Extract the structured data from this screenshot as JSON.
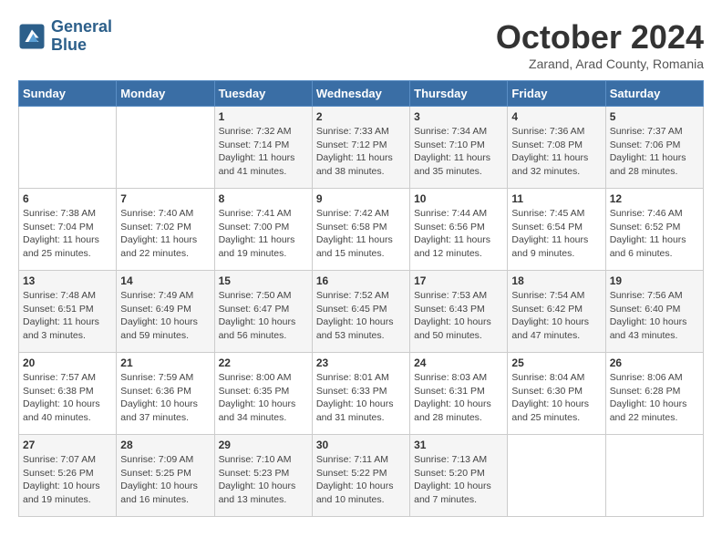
{
  "header": {
    "logo": {
      "line1": "General",
      "line2": "Blue"
    },
    "title": "October 2024",
    "location": "Zarand, Arad County, Romania"
  },
  "weekdays": [
    "Sunday",
    "Monday",
    "Tuesday",
    "Wednesday",
    "Thursday",
    "Friday",
    "Saturday"
  ],
  "weeks": [
    [
      {
        "day": "",
        "info": ""
      },
      {
        "day": "",
        "info": ""
      },
      {
        "day": "1",
        "info": "Sunrise: 7:32 AM\nSunset: 7:14 PM\nDaylight: 11 hours and 41 minutes."
      },
      {
        "day": "2",
        "info": "Sunrise: 7:33 AM\nSunset: 7:12 PM\nDaylight: 11 hours and 38 minutes."
      },
      {
        "day": "3",
        "info": "Sunrise: 7:34 AM\nSunset: 7:10 PM\nDaylight: 11 hours and 35 minutes."
      },
      {
        "day": "4",
        "info": "Sunrise: 7:36 AM\nSunset: 7:08 PM\nDaylight: 11 hours and 32 minutes."
      },
      {
        "day": "5",
        "info": "Sunrise: 7:37 AM\nSunset: 7:06 PM\nDaylight: 11 hours and 28 minutes."
      }
    ],
    [
      {
        "day": "6",
        "info": "Sunrise: 7:38 AM\nSunset: 7:04 PM\nDaylight: 11 hours and 25 minutes."
      },
      {
        "day": "7",
        "info": "Sunrise: 7:40 AM\nSunset: 7:02 PM\nDaylight: 11 hours and 22 minutes."
      },
      {
        "day": "8",
        "info": "Sunrise: 7:41 AM\nSunset: 7:00 PM\nDaylight: 11 hours and 19 minutes."
      },
      {
        "day": "9",
        "info": "Sunrise: 7:42 AM\nSunset: 6:58 PM\nDaylight: 11 hours and 15 minutes."
      },
      {
        "day": "10",
        "info": "Sunrise: 7:44 AM\nSunset: 6:56 PM\nDaylight: 11 hours and 12 minutes."
      },
      {
        "day": "11",
        "info": "Sunrise: 7:45 AM\nSunset: 6:54 PM\nDaylight: 11 hours and 9 minutes."
      },
      {
        "day": "12",
        "info": "Sunrise: 7:46 AM\nSunset: 6:52 PM\nDaylight: 11 hours and 6 minutes."
      }
    ],
    [
      {
        "day": "13",
        "info": "Sunrise: 7:48 AM\nSunset: 6:51 PM\nDaylight: 11 hours and 3 minutes."
      },
      {
        "day": "14",
        "info": "Sunrise: 7:49 AM\nSunset: 6:49 PM\nDaylight: 10 hours and 59 minutes."
      },
      {
        "day": "15",
        "info": "Sunrise: 7:50 AM\nSunset: 6:47 PM\nDaylight: 10 hours and 56 minutes."
      },
      {
        "day": "16",
        "info": "Sunrise: 7:52 AM\nSunset: 6:45 PM\nDaylight: 10 hours and 53 minutes."
      },
      {
        "day": "17",
        "info": "Sunrise: 7:53 AM\nSunset: 6:43 PM\nDaylight: 10 hours and 50 minutes."
      },
      {
        "day": "18",
        "info": "Sunrise: 7:54 AM\nSunset: 6:42 PM\nDaylight: 10 hours and 47 minutes."
      },
      {
        "day": "19",
        "info": "Sunrise: 7:56 AM\nSunset: 6:40 PM\nDaylight: 10 hours and 43 minutes."
      }
    ],
    [
      {
        "day": "20",
        "info": "Sunrise: 7:57 AM\nSunset: 6:38 PM\nDaylight: 10 hours and 40 minutes."
      },
      {
        "day": "21",
        "info": "Sunrise: 7:59 AM\nSunset: 6:36 PM\nDaylight: 10 hours and 37 minutes."
      },
      {
        "day": "22",
        "info": "Sunrise: 8:00 AM\nSunset: 6:35 PM\nDaylight: 10 hours and 34 minutes."
      },
      {
        "day": "23",
        "info": "Sunrise: 8:01 AM\nSunset: 6:33 PM\nDaylight: 10 hours and 31 minutes."
      },
      {
        "day": "24",
        "info": "Sunrise: 8:03 AM\nSunset: 6:31 PM\nDaylight: 10 hours and 28 minutes."
      },
      {
        "day": "25",
        "info": "Sunrise: 8:04 AM\nSunset: 6:30 PM\nDaylight: 10 hours and 25 minutes."
      },
      {
        "day": "26",
        "info": "Sunrise: 8:06 AM\nSunset: 6:28 PM\nDaylight: 10 hours and 22 minutes."
      }
    ],
    [
      {
        "day": "27",
        "info": "Sunrise: 7:07 AM\nSunset: 5:26 PM\nDaylight: 10 hours and 19 minutes."
      },
      {
        "day": "28",
        "info": "Sunrise: 7:09 AM\nSunset: 5:25 PM\nDaylight: 10 hours and 16 minutes."
      },
      {
        "day": "29",
        "info": "Sunrise: 7:10 AM\nSunset: 5:23 PM\nDaylight: 10 hours and 13 minutes."
      },
      {
        "day": "30",
        "info": "Sunrise: 7:11 AM\nSunset: 5:22 PM\nDaylight: 10 hours and 10 minutes."
      },
      {
        "day": "31",
        "info": "Sunrise: 7:13 AM\nSunset: 5:20 PM\nDaylight: 10 hours and 7 minutes."
      },
      {
        "day": "",
        "info": ""
      },
      {
        "day": "",
        "info": ""
      }
    ]
  ]
}
